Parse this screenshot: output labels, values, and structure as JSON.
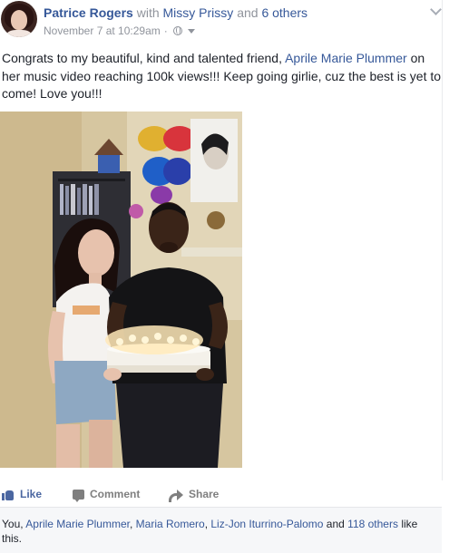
{
  "post": {
    "author": "Patrice Rogers",
    "with_text": "with",
    "tagged": "Missy Prissy",
    "and_text": "and",
    "others": "6 others",
    "timestamp": "November 7 at 10:29am",
    "separator": "·",
    "text_1": "Congrats to my beautiful, kind and talented friend,",
    "mention": "Aprile Marie Plummer",
    "text_2": "on her music video reaching 100k views!!! Keep going girlie, cuz the best is yet to come! Love you!!!"
  },
  "actions": {
    "like": "Like",
    "comment": "Comment",
    "share": "Share"
  },
  "likes": {
    "you": "You,",
    "name_1": "Aprile Marie Plummer",
    "comma": ",",
    "name_2": "Maria Romero",
    "name_3": "Liz-Jon Iturrino-Palomo",
    "and": "and",
    "others": "118 others",
    "suffix": "like this."
  },
  "colors": {
    "link": "#365899",
    "like_active": "#4b67a1",
    "meta": "#90949c"
  }
}
